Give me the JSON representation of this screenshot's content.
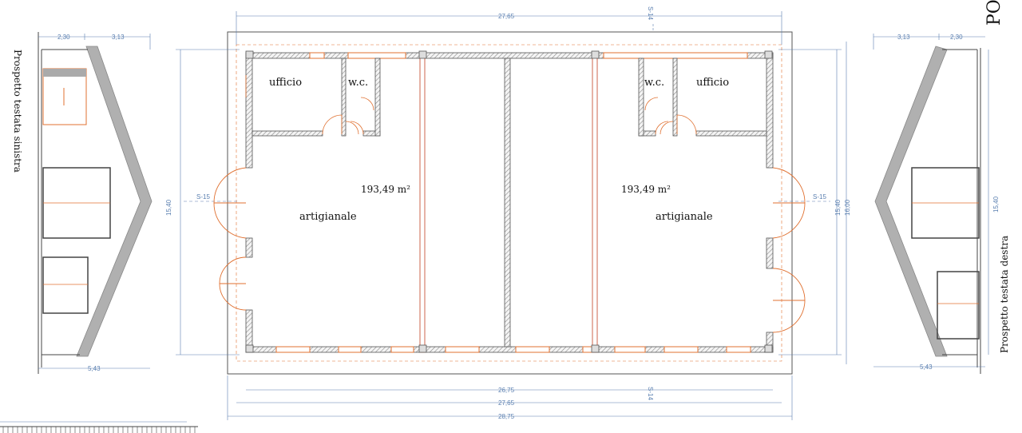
{
  "colors": {
    "dimension": "#5a7fb0",
    "wall": "#555555",
    "door": "#e07030",
    "window": "#e07030",
    "roof": "#b0b0b0"
  },
  "dims": {
    "top_total": "27,65",
    "top_section": "S-14",
    "bottom_section": "S-14",
    "bottom_inner": "26,75",
    "bottom_mid": "27,65",
    "bottom_outer": "28,75",
    "left_height": "15,40",
    "left_section": "S-15",
    "right_section": "S-15",
    "right_inner": "15,40",
    "right_outer": "16,00",
    "left_elev_a": "2,30",
    "left_elev_b": "3,13",
    "left_elev_width": "5,43",
    "right_elev_a": "3,13",
    "right_elev_b": "2,30",
    "right_elev_width": "5,43",
    "right_elev_height": "15,40"
  },
  "rooms": {
    "left_office": "ufficio",
    "left_wc": "w.c.",
    "right_office": "ufficio",
    "right_wc": "w.c.",
    "left_area": "193,49 m²",
    "right_area": "193,49 m²",
    "left_use": "artigianale",
    "right_use": "artigianale"
  },
  "labels": {
    "left_elevation": "Prospetto testata sinistra",
    "right_elevation": "Prospetto testata destra",
    "corner_text": "PO"
  }
}
